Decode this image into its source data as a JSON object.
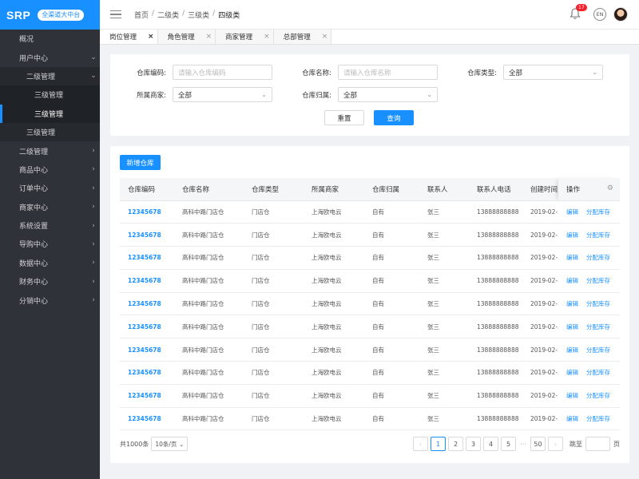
{
  "logo": {
    "text": "SRP",
    "badge": "全渠道大中台"
  },
  "sidebar": {
    "items": [
      {
        "label": "概况",
        "level": 0,
        "chevron": "",
        "active": false
      },
      {
        "label": "用户中心",
        "level": 0,
        "chevron": "⌄",
        "active": false
      },
      {
        "label": "二级管理",
        "level": 1,
        "chevron": "⌄",
        "active": false
      },
      {
        "label": "三级管理",
        "level": 2,
        "chevron": "",
        "active": false
      },
      {
        "label": "三级管理",
        "level": 2,
        "chevron": "",
        "active": true
      },
      {
        "label": "三级管理",
        "level": 1,
        "chevron": "",
        "active": false
      },
      {
        "label": "二级管理",
        "level": 0,
        "chevron": "›",
        "active": false
      },
      {
        "label": "商品中心",
        "level": 0,
        "chevron": "›",
        "active": false
      },
      {
        "label": "订单中心",
        "level": 0,
        "chevron": "›",
        "active": false
      },
      {
        "label": "商家中心",
        "level": 0,
        "chevron": "›",
        "active": false
      },
      {
        "label": "系统设置",
        "level": 0,
        "chevron": "›",
        "active": false
      },
      {
        "label": "导购中心",
        "level": 0,
        "chevron": "›",
        "active": false
      },
      {
        "label": "数据中心",
        "level": 0,
        "chevron": "›",
        "active": false
      },
      {
        "label": "财务中心",
        "level": 0,
        "chevron": "›",
        "active": false
      },
      {
        "label": "分销中心",
        "level": 0,
        "chevron": "›",
        "active": false
      }
    ]
  },
  "header": {
    "breadcrumb": [
      "首页",
      "二级类",
      "三级类",
      "四级类"
    ],
    "separator": "/",
    "notification_count": "17",
    "lang": "EN"
  },
  "tabs": [
    {
      "label": "岗位管理",
      "active": true
    },
    {
      "label": "角色管理",
      "active": false
    },
    {
      "label": "商家管理",
      "active": false
    },
    {
      "label": "总部管理",
      "active": false
    }
  ],
  "tab_close": "×",
  "filter": {
    "code_label": "仓库编码:",
    "code_placeholder": "请输入仓库编码",
    "name_label": "仓库名称:",
    "name_placeholder": "请输入仓库名称",
    "type_label": "仓库类型:",
    "type_value": "全部",
    "merchant_label": "所属商家:",
    "merchant_value": "全部",
    "owner_label": "仓库归属:",
    "owner_value": "全部",
    "reset": "重置",
    "query": "查询"
  },
  "table": {
    "add_button": "新增仓库",
    "headers": [
      "仓库编码",
      "仓库名称",
      "仓库类型",
      "所属商家",
      "仓库归属",
      "联系人",
      "联系人电话",
      "创建时间",
      "操作"
    ],
    "row": {
      "code": "12345678",
      "name": "高科中路门店仓",
      "type": "门店仓",
      "merchant": "上海欧电云",
      "owner": "自有",
      "contact": "张三",
      "phone": "13888888888",
      "created": "2019-02-..."
    },
    "row_count": 10,
    "ops": [
      "编辑",
      "分配库存"
    ]
  },
  "pagination": {
    "total": "共1000条",
    "page_size": "10条/页",
    "prev": "‹",
    "next": "›",
    "pages": [
      "1",
      "2",
      "3",
      "4",
      "5"
    ],
    "ellipsis": "···",
    "last": "50",
    "current": "1",
    "jump_label": "跳至",
    "jump_suffix": "页"
  }
}
